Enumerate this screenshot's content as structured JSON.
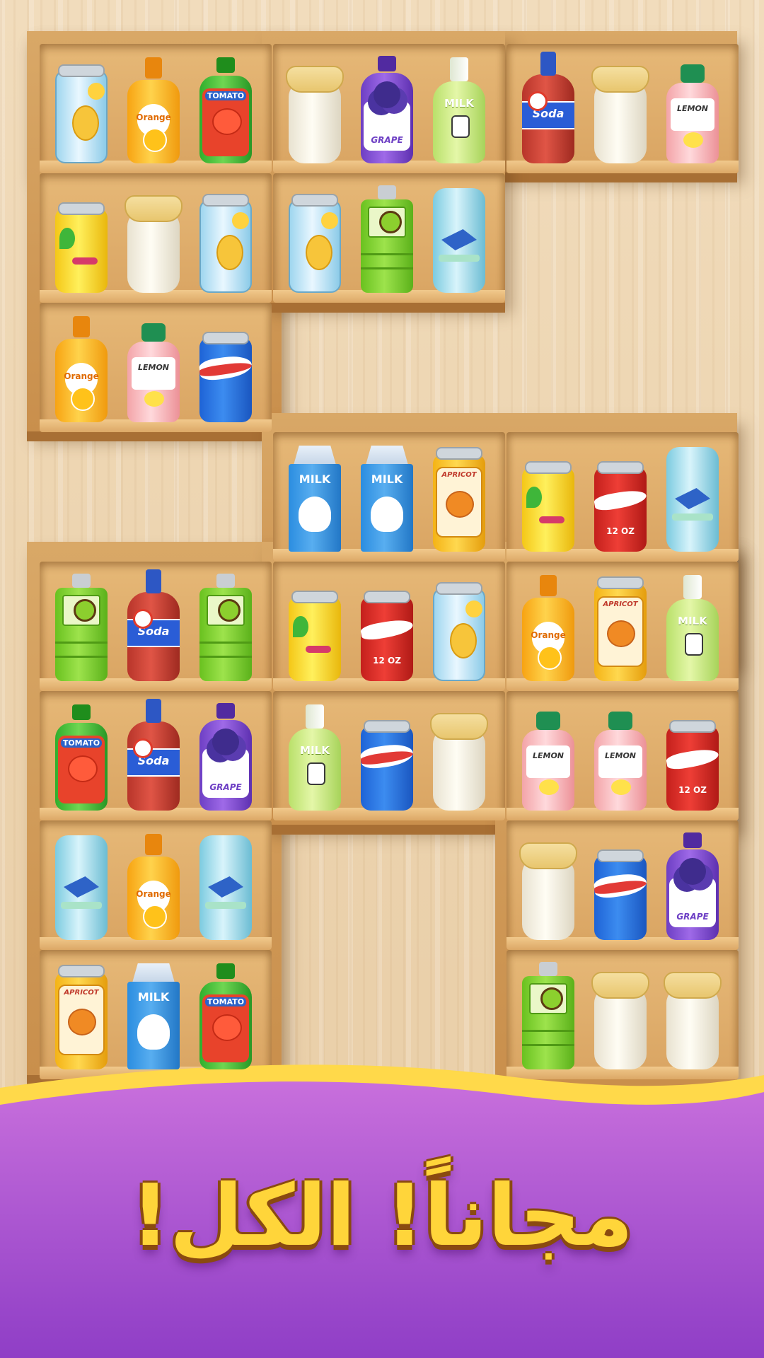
{
  "banner": {
    "text": "مجاناً! الكل!",
    "colors": {
      "purple_top": "#c86fdc",
      "purple_bottom": "#8f3ec6",
      "wave_yellow": "#ffd94a",
      "text": "#ffd53a"
    }
  },
  "palette": {
    "wood": "#d9a462",
    "wood_dark": "#a86f34",
    "floor": "#ecd3ae"
  },
  "product_types": {
    "pineapple_can": {
      "label": "",
      "icon": "pineapple-icon"
    },
    "orange_juice": {
      "label": "Orange",
      "icon": "orange-slice-icon"
    },
    "tomato_juice": {
      "label": "TOMATO",
      "icon": "tomato-icon"
    },
    "milk_jar": {
      "label": "",
      "icon": "cloth-lid-icon"
    },
    "grape_bottle": {
      "label": "GRAPE",
      "icon": "grape-icon"
    },
    "milk_bottle": {
      "label": "MILK",
      "icon": "cow-icon"
    },
    "soda_bottle": {
      "label": "Soda",
      "icon": "soda-logo-icon"
    },
    "lemon_juice": {
      "label": "LEMON",
      "icon": "lemon-icon"
    },
    "yellow_can": {
      "label": "",
      "icon": "leaf-icon"
    },
    "kiwi_jug": {
      "label": "",
      "icon": "kiwi-icon"
    },
    "blue_bottle": {
      "label": "",
      "icon": "diamond-icon"
    },
    "wave_can": {
      "label": "",
      "icon": "wave-icon"
    },
    "milk_carton": {
      "label": "MILK",
      "icon": "milk-splash-icon"
    },
    "apricot_can": {
      "label": "APRICOT",
      "icon": "apricot-icon"
    },
    "cola_can": {
      "label": "12 OZ",
      "icon": "wave-icon"
    }
  },
  "shelves": [
    {
      "row": 0,
      "col": 0,
      "items": [
        "pineapple_can",
        "orange_juice",
        "tomato_juice"
      ]
    },
    {
      "row": 0,
      "col": 1,
      "items": [
        "milk_jar",
        "grape_bottle",
        "milk_bottle"
      ]
    },
    {
      "row": 0,
      "col": 2,
      "items": [
        "soda_bottle",
        "milk_jar",
        "lemon_juice"
      ]
    },
    {
      "row": 1,
      "col": 0,
      "items": [
        "yellow_can",
        "milk_jar",
        "pineapple_can"
      ]
    },
    {
      "row": 1,
      "col": 1,
      "items": [
        "pineapple_can",
        "kiwi_jug",
        "blue_bottle"
      ]
    },
    {
      "row": 2,
      "col": 0,
      "items": [
        "orange_juice",
        "lemon_juice",
        "wave_can"
      ]
    },
    {
      "row": 3,
      "col": 1,
      "items": [
        "milk_carton",
        "milk_carton",
        "apricot_can"
      ]
    },
    {
      "row": 3,
      "col": 2,
      "items": [
        "yellow_can",
        "cola_can",
        "blue_bottle"
      ]
    },
    {
      "row": 4,
      "col": 0,
      "items": [
        "kiwi_jug",
        "soda_bottle",
        "kiwi_jug"
      ]
    },
    {
      "row": 4,
      "col": 1,
      "items": [
        "yellow_can",
        "cola_can",
        "pineapple_can"
      ]
    },
    {
      "row": 4,
      "col": 2,
      "items": [
        "orange_juice",
        "apricot_can",
        "milk_bottle"
      ]
    },
    {
      "row": 5,
      "col": 0,
      "items": [
        "tomato_juice",
        "soda_bottle",
        "grape_bottle"
      ]
    },
    {
      "row": 5,
      "col": 1,
      "items": [
        "milk_bottle",
        "wave_can",
        "milk_jar"
      ]
    },
    {
      "row": 5,
      "col": 2,
      "items": [
        "lemon_juice",
        "lemon_juice",
        "cola_can"
      ]
    },
    {
      "row": 6,
      "col": 0,
      "items": [
        "blue_bottle",
        "orange_juice",
        "blue_bottle"
      ]
    },
    {
      "row": 6,
      "col": 2,
      "items": [
        "milk_jar",
        "wave_can",
        "grape_bottle"
      ]
    },
    {
      "row": 7,
      "col": 0,
      "items": [
        "apricot_can",
        "milk_carton",
        "tomato_juice"
      ]
    },
    {
      "row": 7,
      "col": 2,
      "items": [
        "kiwi_jug",
        "milk_jar",
        "milk_jar"
      ]
    }
  ]
}
